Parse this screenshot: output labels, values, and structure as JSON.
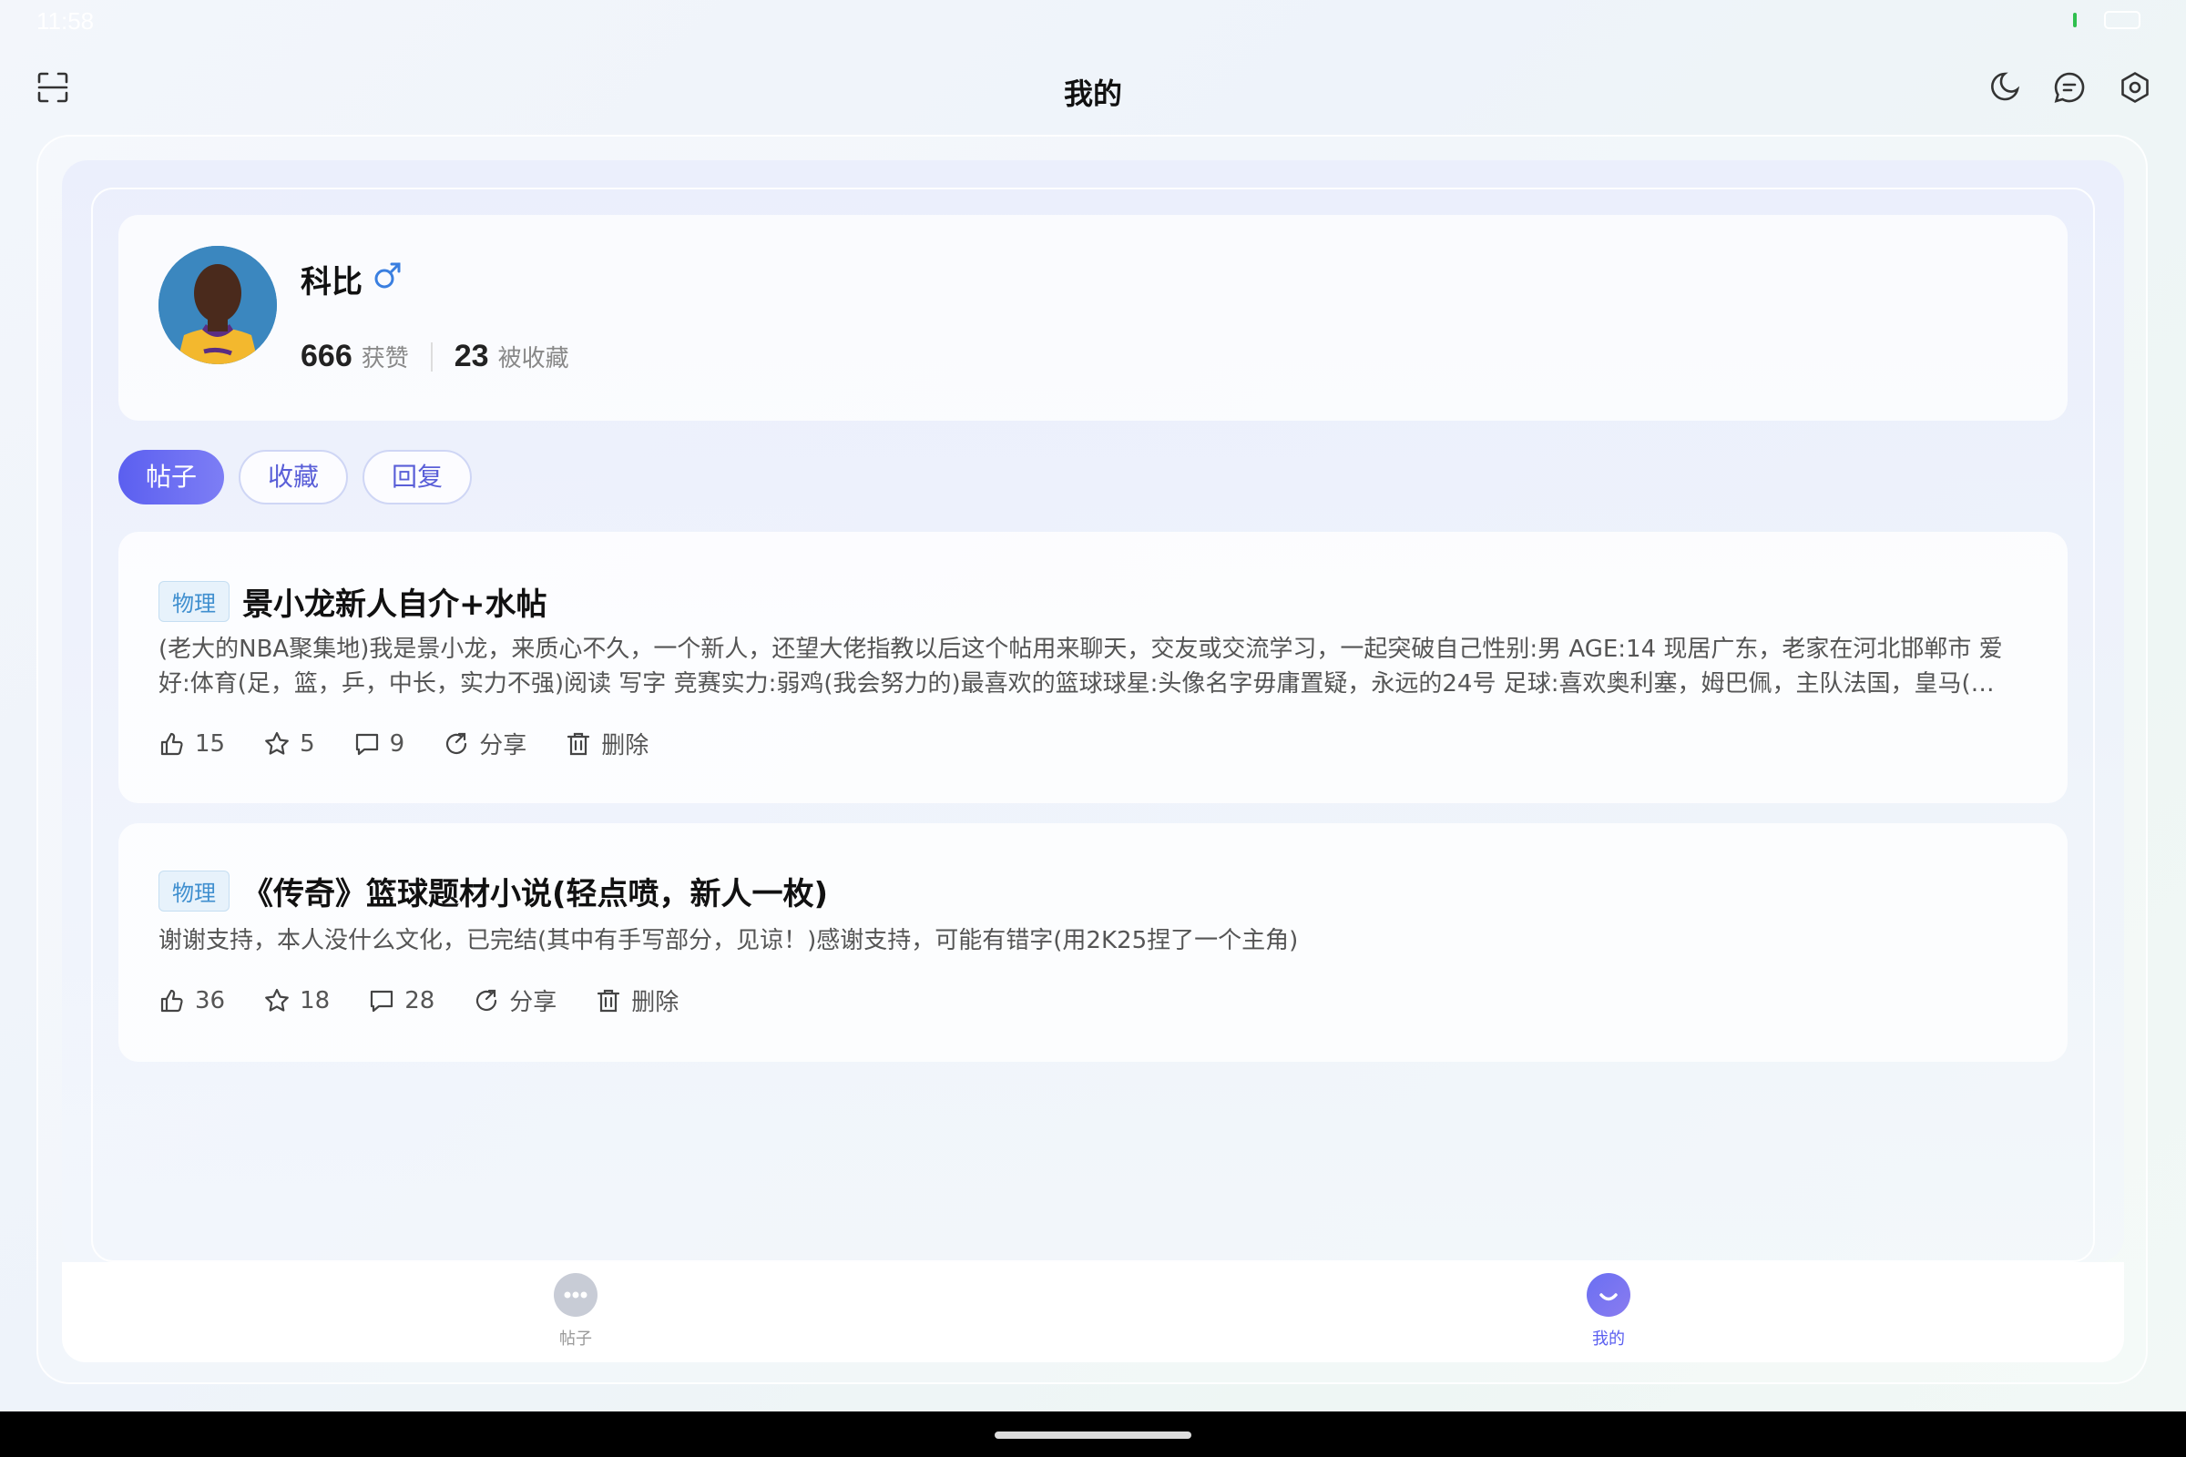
{
  "status": {
    "time": "11:58"
  },
  "header": {
    "title": "我的"
  },
  "profile": {
    "name": "科比",
    "likes_count": "666",
    "likes_label": "获赞",
    "favorited_count": "23",
    "favorited_label": "被收藏"
  },
  "tabs": [
    {
      "label": "帖子",
      "active": true
    },
    {
      "label": "收藏",
      "active": false
    },
    {
      "label": "回复",
      "active": false
    }
  ],
  "posts": [
    {
      "tag": "物理",
      "title": "景小龙新人自介+水帖",
      "body": "(老大的NBA聚集地)我是景小龙，来质心不久，一个新人，还望大佬指教以后这个帖用来聊天，交友或交流学习，一起突破自己性别:男 AGE:14 现居广东，老家在河北邯郸市 爱好:体育(足，篮，乒，中长，实力不强)阅读 写字 竞赛实力:弱鸡(我会努力的)最喜欢的篮球球星:头像名字毋庸置疑，永远的24号 足球:喜欢奥利塞，姆巴佩，主队法国，皇马(不搞饭…",
      "likes": "15",
      "stars": "5",
      "comments": "9",
      "share_label": "分享",
      "delete_label": "删除"
    },
    {
      "tag": "物理",
      "title": "《传奇》篮球题材小说(轻点喷，新人一枚)",
      "body": "谢谢支持，本人没什么文化，已完结(其中有手写部分，见谅！)感谢支持，可能有错字(用2K25捏了一个主角)",
      "likes": "36",
      "stars": "18",
      "comments": "28",
      "share_label": "分享",
      "delete_label": "删除"
    }
  ],
  "bottom_nav": [
    {
      "label": "帖子",
      "active": false
    },
    {
      "label": "我的",
      "active": true
    }
  ],
  "colors": {
    "accent": "#5b5ff0",
    "tag_text": "#3f8fcf",
    "tag_bg": "#e7f2fb",
    "nav_inactive": "#c8ccd6"
  }
}
